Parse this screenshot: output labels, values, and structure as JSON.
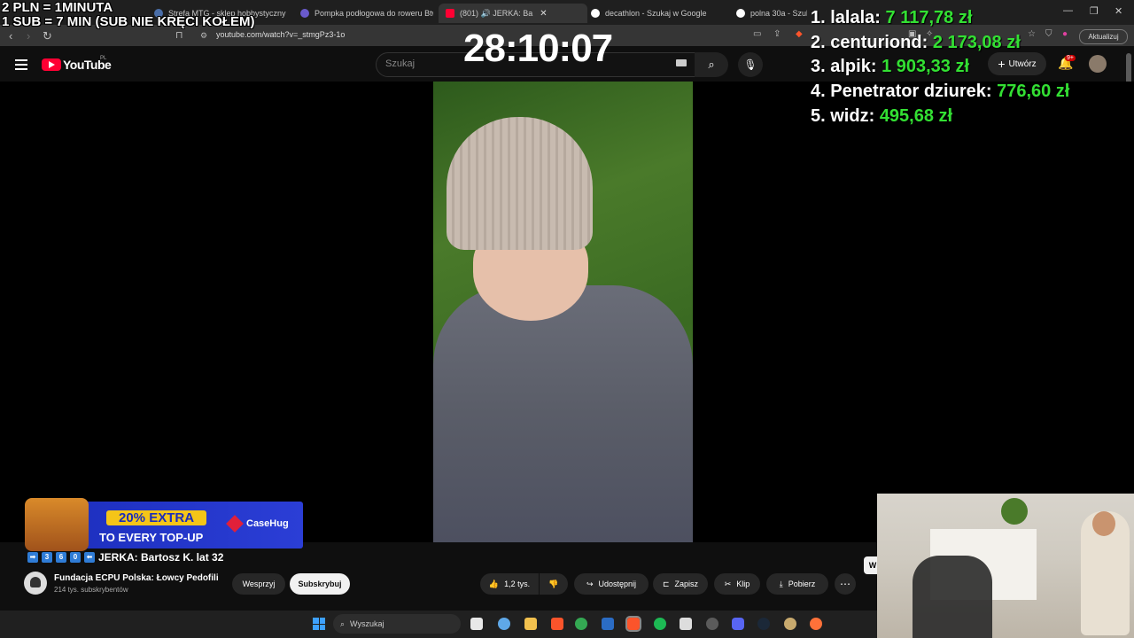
{
  "overlay": {
    "line1": "2 PLN = 1MINUTA",
    "line2": "1 SUB = 7 MIN (SUB NIE KRĘCI KOŁEM)",
    "timer": "28:10:07",
    "leaderboard": [
      {
        "rank": "1.",
        "name": "lalala:",
        "amount": "7 117,78 zł"
      },
      {
        "rank": "2.",
        "name": "centuriond:",
        "amount": "2 173,08 zł"
      },
      {
        "rank": "3.",
        "name": "alpik:",
        "amount": "1 903,33 zł"
      },
      {
        "rank": "4.",
        "name": "Penetrator dziurek:",
        "amount": "776,60 zł"
      },
      {
        "rank": "5.",
        "name": "widz:",
        "amount": "495,68 zł"
      }
    ]
  },
  "browser": {
    "tabs": [
      {
        "label": "Strefa MTG - sklep hobbystyczny",
        "color": "#4a6ea8"
      },
      {
        "label": "Pompka podłogowa do roweru Btwin",
        "color": "#6a5acd"
      },
      {
        "label": "(801) 🔊 JERKA: Ba",
        "color": "#ff0033"
      },
      {
        "label": "decathlon - Szukaj w Google",
        "color": "#ffffff"
      },
      {
        "label": "polna 30a - Szukaj w Google",
        "color": "#ffffff"
      }
    ],
    "url": "youtube.com/watch?v=_stmgPz3-1o",
    "update_button": "Aktualizuj"
  },
  "youtube": {
    "logo_text": "YouTube",
    "country_code": "PL",
    "search_placeholder": "Szukaj",
    "create_label": "Utwórz",
    "notif_badge": "9+",
    "video_title": "JERKA: Bartosz K. lat 32",
    "title_keycaps": [
      "3",
      "6",
      "0"
    ],
    "channel_name": "Fundacja ECPU Polska: Łowcy Pedofili",
    "channel_subs": "214 tys. subskrybentów",
    "support_button": "Wesprzyj",
    "subscribe_button": "Subskrybuj",
    "likes": "1,2 tys.",
    "share_label": "Udostępnij",
    "save_label": "Zapisz",
    "clip_label": "Klip",
    "download_label": "Pobierz"
  },
  "ad": {
    "line1": "20% EXTRA",
    "line2": "TO EVERY TOP-UP",
    "brand": "CaseHug"
  },
  "taskbar": {
    "search_placeholder": "Wyszukaj"
  },
  "colors": {
    "accent_red": "#ff0033",
    "money_green": "#33e033"
  }
}
